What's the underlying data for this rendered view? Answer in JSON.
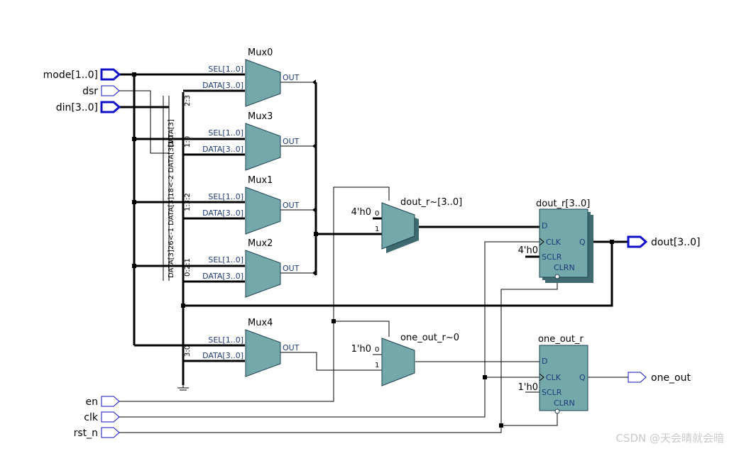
{
  "ports": {
    "mode": "mode[1..0]",
    "dsr": "dsr",
    "din": "din[3..0]",
    "en": "en",
    "clk": "clk",
    "rst_n": "rst_n",
    "dout": "dout[3..0]",
    "one_out": "one_out"
  },
  "muxes": {
    "mux0": "Mux0",
    "mux3": "Mux3",
    "mux1": "Mux1",
    "mux2": "Mux2",
    "mux4": "Mux4"
  },
  "mux_pins": {
    "sel": "SEL[1..0]",
    "data": "DATA[3..0]",
    "out": "OUT"
  },
  "selectors": {
    "dout_mux": "dout_r~[3..0]",
    "one_mux": "one_out_r~0",
    "dout_const": "4'h0",
    "one_const": "1'h0",
    "in0": "0",
    "in1": "1"
  },
  "flipflops": {
    "dout_reg": "dout_r[3..0]",
    "one_reg": "one_out_r",
    "d": "D",
    "clk": "CLK",
    "sclr": "SCLR",
    "clrn": "CLRN",
    "q": "Q",
    "dout_sclr_const": "4'h0",
    "one_sclr_const": "1'h0"
  },
  "bus_labels": {
    "b1": "2:3",
    "b2": "1:0",
    "b3": "1:3:2",
    "b4": "0:2:1",
    "b5": "3:0",
    "r1": "DATA[3]26<-1 DATA[3]18<-2 DATA[3]10",
    "r2": "DATA[3]"
  },
  "watermark": "CSDN @天会晴就会暗"
}
